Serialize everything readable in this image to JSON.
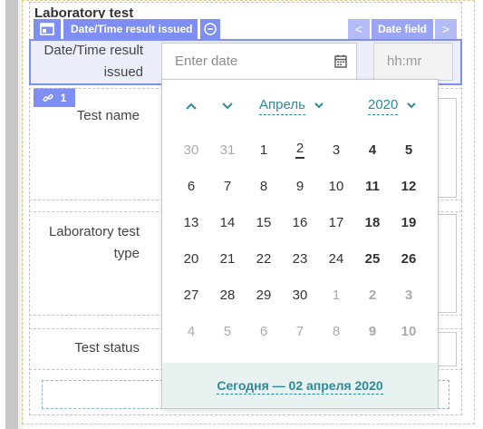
{
  "form": {
    "section_title": "Laboratory test",
    "toolbar": {
      "field_label": "Date/Time result issued",
      "field_type": "Date field",
      "prev": "<",
      "next": ">"
    },
    "selected_field": {
      "label": "Date/Time result issued",
      "date_placeholder": "Enter date",
      "time_placeholder": "hh:mr"
    },
    "link_badge": "1",
    "rows": [
      {
        "label": "Test name"
      },
      {
        "label": "Laboratory test type"
      },
      {
        "label": "Test status"
      }
    ]
  },
  "calendar": {
    "month": "Апрель",
    "year": "2020",
    "today_label": "Сегодня — 02 апреля 2020",
    "weeks": [
      [
        {
          "d": "30",
          "out": true
        },
        {
          "d": "31",
          "out": true
        },
        {
          "d": "1"
        },
        {
          "d": "2",
          "today": true
        },
        {
          "d": "3"
        },
        {
          "d": "4",
          "we": true
        },
        {
          "d": "5",
          "we": true
        }
      ],
      [
        {
          "d": "6"
        },
        {
          "d": "7"
        },
        {
          "d": "8"
        },
        {
          "d": "9"
        },
        {
          "d": "10"
        },
        {
          "d": "11",
          "we": true
        },
        {
          "d": "12",
          "we": true
        }
      ],
      [
        {
          "d": "13"
        },
        {
          "d": "14"
        },
        {
          "d": "15"
        },
        {
          "d": "16"
        },
        {
          "d": "17"
        },
        {
          "d": "18",
          "we": true
        },
        {
          "d": "19",
          "we": true
        }
      ],
      [
        {
          "d": "20"
        },
        {
          "d": "21"
        },
        {
          "d": "22"
        },
        {
          "d": "23"
        },
        {
          "d": "24"
        },
        {
          "d": "25",
          "we": true
        },
        {
          "d": "26",
          "we": true
        }
      ],
      [
        {
          "d": "27"
        },
        {
          "d": "28"
        },
        {
          "d": "29"
        },
        {
          "d": "30"
        },
        {
          "d": "1",
          "out": true
        },
        {
          "d": "2",
          "out": true,
          "we": true
        },
        {
          "d": "3",
          "out": true,
          "we": true
        }
      ],
      [
        {
          "d": "4",
          "out": true
        },
        {
          "d": "5",
          "out": true
        },
        {
          "d": "6",
          "out": true
        },
        {
          "d": "7",
          "out": true
        },
        {
          "d": "8",
          "out": true
        },
        {
          "d": "9",
          "out": true,
          "we": true
        },
        {
          "d": "10",
          "out": true,
          "we": true
        }
      ]
    ]
  },
  "colors": {
    "accent": "#7f8ef2",
    "teal": "#2b8a9b",
    "footer_bg": "#e8f3f1"
  }
}
